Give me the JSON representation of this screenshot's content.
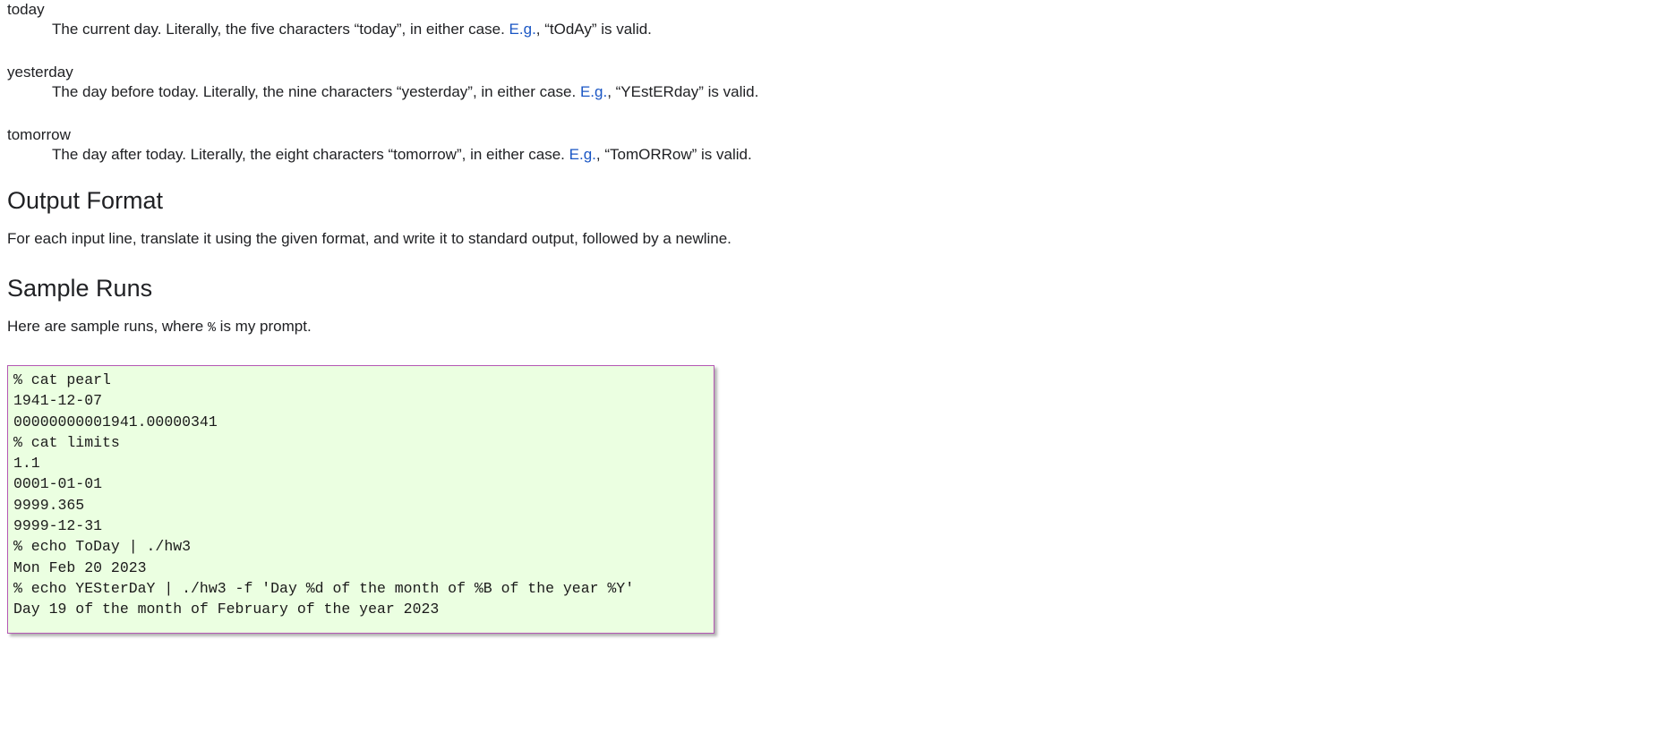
{
  "definitions": [
    {
      "term": "today",
      "desc_before": "The current day. Literally, the five characters “today”, in either case. ",
      "link": "E.g.",
      "desc_after": ", “tOdAy” is valid."
    },
    {
      "term": "yesterday",
      "desc_before": "The day before today. Literally, the nine characters “yesterday”, in either case. ",
      "link": "E.g.",
      "desc_after": ", “YEstERday” is valid."
    },
    {
      "term": "tomorrow",
      "desc_before": "The day after today. Literally, the eight characters “tomorrow”, in either case. ",
      "link": "E.g.",
      "desc_after": ", “TomORRow” is valid."
    }
  ],
  "sections": {
    "output_format": {
      "heading": "Output Format",
      "paragraph": "For each input line, translate it using the given format, and write it to standard output, followed by a newline."
    },
    "sample_runs": {
      "heading": "Sample Runs",
      "paragraph_before": "Here are sample runs, where ",
      "paragraph_code": "%",
      "paragraph_after": " is my prompt."
    }
  },
  "terminal": {
    "lines": [
      "% cat pearl",
      "1941-12-07",
      "00000000001941.00000341",
      "% cat limits",
      "1.1",
      "0001-01-01",
      "9999.365",
      "9999-12-31",
      "% echo ToDay | ./hw3",
      "Mon Feb 20 2023",
      "% echo YESterDaY | ./hw3 -f 'Day %d of the month of %B of the year %Y'",
      "Day 19 of the month of February of the year 2023"
    ]
  },
  "colors": {
    "link": "#1a56c4",
    "code_background": "#ebffe1",
    "code_border": "#b457b4",
    "text": "#202124"
  }
}
